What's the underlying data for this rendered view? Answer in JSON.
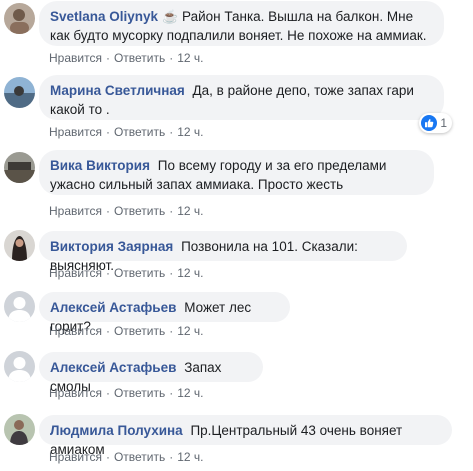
{
  "comments": [
    {
      "author": "Svetlana Oliynyk",
      "author_icon": "coffee-cup-icon",
      "author_icon_glyph": "☕",
      "text": "Район Танка. Вышла на балкон. Мне как будто мусорку подпалили воняет. Не похоже на аммиак.",
      "like": "Нравится",
      "reply": "Ответить",
      "time": "12 ч."
    },
    {
      "author": "Марина Светличная",
      "text": "Да, в районе депо, тоже запах гари какой то .",
      "like": "Нравится",
      "reply": "Ответить",
      "time": "12 ч.",
      "reactions": "1"
    },
    {
      "author": "Вика Виктория",
      "text": "По всему городу и за его пределами ужасно сильный запах аммиака. Просто жесть",
      "like": "Нравится",
      "reply": "Ответить",
      "time": "12 ч."
    },
    {
      "author": "Виктория Заярная",
      "text": "Позвонила на 101. Сказали: выясняют.",
      "like": "Нравится",
      "reply": "Ответить",
      "time": "12 ч."
    },
    {
      "author": "Алексей Астафьев",
      "text": "Может лес горит?",
      "like": "Нравится",
      "reply": "Ответить",
      "time": "12 ч."
    },
    {
      "author": "Алексей Астафьев",
      "text": "Запах смолы",
      "like": "Нравится",
      "reply": "Ответить",
      "time": "12 ч."
    },
    {
      "author": "Людмила Полухина",
      "text": "Пр.Центральный 43 очень воняет амиаком",
      "like": "Нравится",
      "reply": "Ответить",
      "time": "12 ч."
    }
  ],
  "colors": {
    "author": "#385898",
    "bubble": "#f2f3f5",
    "meta": "#606770",
    "like_badge": "#1877f2"
  },
  "icons": {
    "reaction": "thumbs-up-icon",
    "separator": "·"
  }
}
